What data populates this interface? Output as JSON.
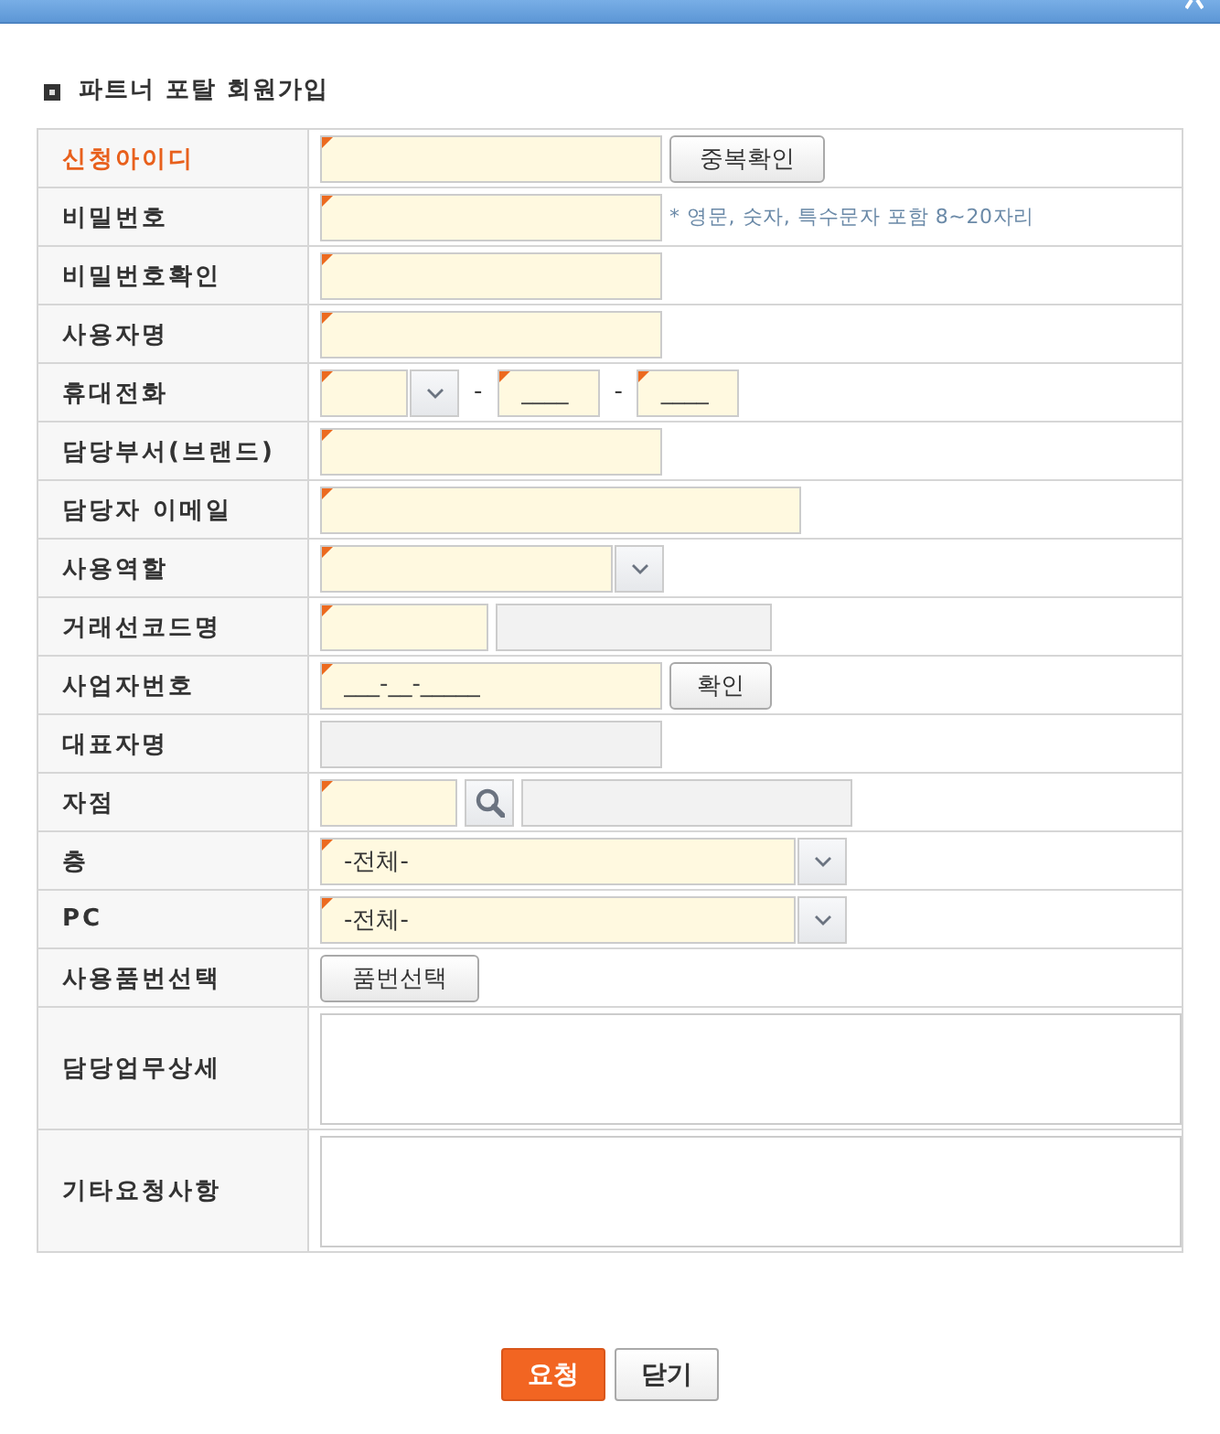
{
  "heading": "파트너 포탈 회원가입",
  "form": {
    "rows": [
      {
        "label": "신청아이디",
        "highlighted": true,
        "controls": [
          {
            "kind": "input",
            "required": true,
            "disabled": false
          },
          {
            "kind": "button",
            "label": "중복확인"
          }
        ]
      },
      {
        "label": "비밀번호",
        "highlighted": false,
        "controls": [
          {
            "kind": "input",
            "required": true,
            "disabled": false
          },
          {
            "kind": "hint",
            "text": "* 영문, 숫자, 특수문자 포함 8~20자리"
          }
        ]
      },
      {
        "label": "비밀번호확인",
        "highlighted": false,
        "controls": [
          {
            "kind": "input",
            "required": true,
            "disabled": false
          }
        ]
      },
      {
        "label": "사용자명",
        "highlighted": false,
        "controls": [
          {
            "kind": "input",
            "required": true,
            "disabled": false
          }
        ]
      },
      {
        "label": "휴대전화",
        "highlighted": false,
        "controls": [
          {
            "kind": "select",
            "required": true,
            "disabled": false
          },
          {
            "kind": "text",
            "text": "-"
          },
          {
            "kind": "input",
            "required": true,
            "disabled": false,
            "placeholder": "____"
          },
          {
            "kind": "text",
            "text": "-"
          },
          {
            "kind": "input",
            "required": true,
            "disabled": false,
            "placeholder": "____"
          }
        ]
      },
      {
        "label": "담당부서(브랜드)",
        "highlighted": false,
        "controls": [
          {
            "kind": "input",
            "required": true,
            "disabled": false
          }
        ]
      },
      {
        "label": "담당자 이메일",
        "highlighted": false,
        "controls": [
          {
            "kind": "input",
            "required": true,
            "disabled": false
          }
        ]
      },
      {
        "label": "사용역할",
        "highlighted": false,
        "controls": [
          {
            "kind": "select",
            "required": true,
            "disabled": false
          }
        ]
      },
      {
        "label": "거래선코드명",
        "highlighted": false,
        "controls": [
          {
            "kind": "input",
            "required": true,
            "disabled": false
          },
          {
            "kind": "input",
            "required": false,
            "disabled": true
          }
        ]
      },
      {
        "label": "사업자번호",
        "highlighted": false,
        "controls": [
          {
            "kind": "input",
            "required": true,
            "disabled": false,
            "placeholder": "___-__-_____"
          },
          {
            "kind": "button",
            "label": "확인"
          }
        ]
      },
      {
        "label": "대표자명",
        "highlighted": false,
        "controls": [
          {
            "kind": "input",
            "required": false,
            "disabled": true
          }
        ]
      },
      {
        "label": "자점",
        "highlighted": false,
        "controls": [
          {
            "kind": "input",
            "required": true,
            "disabled": false
          },
          {
            "kind": "search-button"
          },
          {
            "kind": "input",
            "required": false,
            "disabled": true
          }
        ]
      },
      {
        "label": "층",
        "highlighted": false,
        "controls": [
          {
            "kind": "select",
            "required": true,
            "disabled": false,
            "value": "-전체-"
          }
        ]
      },
      {
        "label": "PC",
        "highlighted": false,
        "controls": [
          {
            "kind": "select",
            "required": true,
            "disabled": false,
            "value": "-전체-"
          }
        ]
      },
      {
        "label": "사용품번선택",
        "highlighted": false,
        "controls": [
          {
            "kind": "button",
            "label": "품번선택"
          }
        ]
      },
      {
        "label": "담당업무상세",
        "highlighted": false,
        "controls": [
          {
            "kind": "textarea"
          }
        ]
      },
      {
        "label": "기타요청사항",
        "highlighted": false,
        "controls": [
          {
            "kind": "textarea"
          }
        ]
      }
    ]
  },
  "buttons": [
    {
      "label": "요청",
      "primary": true
    },
    {
      "label": "닫기",
      "primary": false
    }
  ]
}
